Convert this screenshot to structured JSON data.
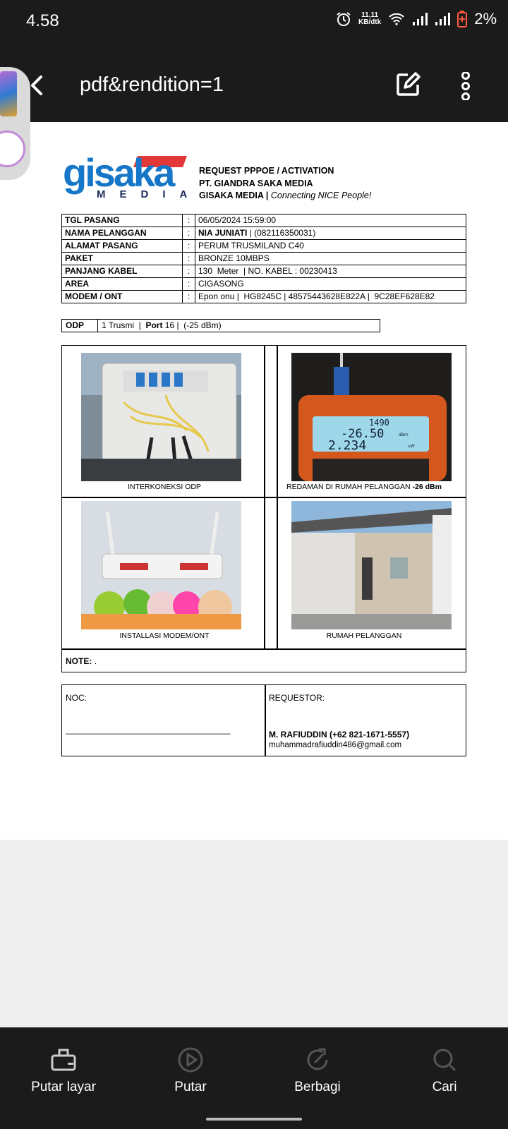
{
  "status_bar": {
    "time": "4.58",
    "net_speed_value": "11,11",
    "net_speed_unit": "KB/dtk",
    "battery": "2%"
  },
  "app_bar": {
    "title": "pdf&rendition=1"
  },
  "document": {
    "logo": {
      "word": "gisaka",
      "sub": "MEDIA"
    },
    "header": {
      "line1": "REQUEST PPPOE / ACTIVATION",
      "line2": "PT. GIANDRA SAKA MEDIA",
      "line3_bold": "GISAKA MEDIA |",
      "line3_italic": "Connecting NICE People!"
    },
    "info_rows": [
      {
        "label": "TGL PASANG",
        "sep": ":",
        "value": "06/05/2024 15:59:00"
      },
      {
        "label": "NAMA PELANGGAN",
        "sep": ":",
        "value_bold": "NIA JUNIATI",
        "value": " | (082116350031)"
      },
      {
        "label": "ALAMAT PASANG",
        "sep": ":",
        "value": "PERUM TRUSMILAND C40"
      },
      {
        "label": "PAKET",
        "sep": ":",
        "value": "BRONZE 10MBPS"
      },
      {
        "label": "PANJANG KABEL",
        "sep": ":",
        "value": "130  Meter  | NO. KABEL : 00230413"
      },
      {
        "label": "AREA",
        "sep": ":",
        "value": "CIGASONG"
      },
      {
        "label": "MODEM / ONT",
        "sep": ":",
        "value": "Epon onu |  HG8245C | 48575443628E822A |  9C28EF628E82"
      }
    ],
    "odp": {
      "label": "ODP",
      "value_prefix": "1 Trusmi  |  ",
      "port_label": "Port",
      "value_suffix": " 16 |  (-25 dBm)"
    },
    "photos": [
      {
        "caption": "INTERKONEKSI ODP"
      },
      {
        "caption": "REDAMAN DI RUMAH PELANGGAN",
        "caption_bold": "-26 dBm",
        "meter_line1": "1490",
        "meter_line2": "-26.50",
        "meter_line3": "2.234",
        "meter_unit1": "dBm",
        "meter_unit2": "uW"
      },
      {
        "caption": "INSTALLASI MODEM/ONT"
      },
      {
        "caption": "RUMAH PELANGGAN"
      }
    ],
    "note": {
      "label": "NOTE:",
      "value": "."
    },
    "signatures": {
      "noc_label": "NOC:",
      "noc_line": "___________________________________",
      "requestor_label": "REQUESTOR:",
      "requestor_name": "M. RAFIUDDIN (+62 821-1671-5557)",
      "requestor_email": "muhammadrafiuddin486@gmail.com"
    }
  },
  "bottom_nav": [
    {
      "label": "Putar layar",
      "icon": "cast-screen-icon"
    },
    {
      "label": "Putar",
      "icon": "play-icon"
    },
    {
      "label": "Berbagi",
      "icon": "share-icon"
    },
    {
      "label": "Cari",
      "icon": "search-icon"
    }
  ]
}
